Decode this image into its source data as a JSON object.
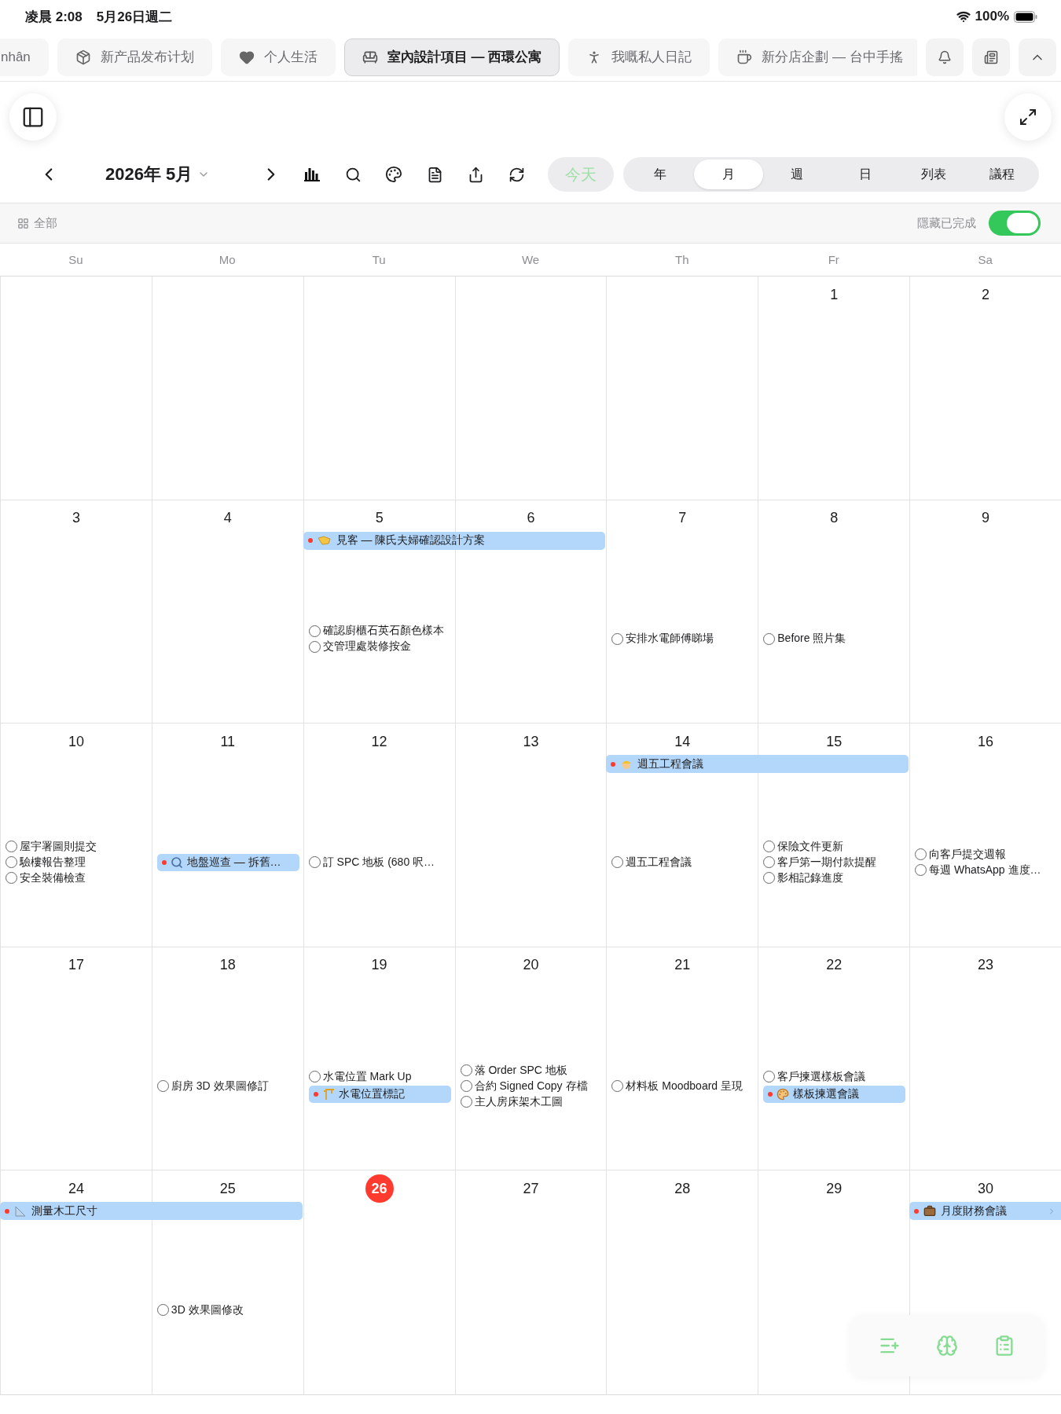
{
  "status_bar": {
    "time": "凌晨 2:08",
    "date": "5月26日週二",
    "battery": "100%"
  },
  "tabs": [
    {
      "label": "nhân",
      "selected": false
    },
    {
      "label": "新产品发布计划",
      "selected": false
    },
    {
      "label": "个人生活",
      "selected": false
    },
    {
      "label": "室內設計項目 — 西環公寓",
      "selected": true
    },
    {
      "label": "我嘅私人日記",
      "selected": false
    },
    {
      "label": "新分店企劃 — 台中手搖",
      "selected": false
    }
  ],
  "toolbar": {
    "month": "2026年 5月",
    "today": "今天",
    "views": [
      {
        "label": "年",
        "selected": false
      },
      {
        "label": "月",
        "selected": true
      },
      {
        "label": "週",
        "selected": false
      },
      {
        "label": "日",
        "selected": false
      },
      {
        "label": "列表",
        "selected": false
      },
      {
        "label": "議程",
        "selected": false
      }
    ]
  },
  "filter_bar": {
    "filter": "全部",
    "hide_completed": {
      "label": "隱藏已完成",
      "on": true
    }
  },
  "weekdays": [
    "Su",
    "Mo",
    "Tu",
    "We",
    "Th",
    "Fr",
    "Sa"
  ],
  "weeks": [
    {
      "days": [
        {
          "date": "1"
        },
        {
          "date": "2"
        }
      ]
    },
    {
      "days": [
        {
          "date": "3"
        },
        {
          "date": "4"
        },
        {
          "date": "5",
          "bar": {
            "title": "見客 — 陳氏夫婦確認設計方案"
          },
          "items": [
            {
              "kind": "task",
              "title": "確認廚櫃石英石顏色樣本",
              "done": false
            },
            {
              "kind": "task",
              "title": "交管理處裝修按金",
              "done": false
            }
          ]
        },
        {
          "date": "6",
          "bar_continues": true
        },
        {
          "date": "7",
          "items": [
            {
              "kind": "task",
              "title": "安排水電師傅睇場",
              "done": false
            }
          ]
        },
        {
          "date": "8",
          "items": [
            {
              "kind": "task",
              "title": "Before 照片集",
              "done": false
            }
          ]
        },
        {
          "date": "9"
        }
      ]
    },
    {
      "days": [
        {
          "date": "10",
          "items": [
            {
              "kind": "task",
              "title": "屋宇署圖則提交",
              "done": false
            },
            {
              "kind": "task",
              "title": "驗樓報告整理",
              "done": false
            },
            {
              "kind": "task",
              "title": "安全裝備檢查",
              "done": false
            }
          ]
        },
        {
          "date": "11",
          "items": [
            {
              "kind": "event",
              "title": "地盤巡查 — 拆舊…"
            }
          ]
        },
        {
          "date": "12",
          "items": [
            {
              "kind": "task",
              "title": "訂 SPC 地板 (680 呎…",
              "done": false
            }
          ]
        },
        {
          "date": "13"
        },
        {
          "date": "14",
          "bar": {
            "title": "週五工程會議"
          },
          "items": [
            {
              "kind": "task",
              "title": "週五工程會議",
              "done": false
            }
          ]
        },
        {
          "date": "15",
          "bar_continues": true,
          "items": [
            {
              "kind": "task",
              "title": "保險文件更新",
              "done": false
            },
            {
              "kind": "task",
              "title": "客戶第一期付款提醒",
              "done": false
            },
            {
              "kind": "task",
              "title": "影相記錄進度",
              "done": false
            }
          ]
        },
        {
          "date": "16",
          "items": [
            {
              "kind": "task",
              "title": "向客戶提交週報",
              "done": false
            },
            {
              "kind": "task",
              "title": "每週 WhatsApp 進度…",
              "done": false
            }
          ]
        }
      ]
    },
    {
      "days": [
        {
          "date": "17"
        },
        {
          "date": "18",
          "items": [
            {
              "kind": "task",
              "title": "廚房 3D 效果圖修訂",
              "done": false
            }
          ]
        },
        {
          "date": "19",
          "items": [
            {
              "kind": "task",
              "title": "水電位置 Mark Up",
              "done": false
            },
            {
              "kind": "event",
              "title": "水電位置標記"
            }
          ]
        },
        {
          "date": "20",
          "items": [
            {
              "kind": "task",
              "title": "落 Order SPC 地板",
              "done": false
            },
            {
              "kind": "task",
              "title": "合約 Signed Copy 存檔",
              "done": false
            },
            {
              "kind": "task",
              "title": "主人房床架木工圖",
              "done": false
            }
          ]
        },
        {
          "date": "21",
          "items": [
            {
              "kind": "task",
              "title": "材料板 Moodboard 呈現",
              "done": false
            }
          ]
        },
        {
          "date": "22",
          "items": [
            {
              "kind": "task",
              "title": "客戶揀選樣板會議",
              "done": false
            },
            {
              "kind": "event",
              "title": "樣板揀選會議"
            }
          ]
        },
        {
          "date": "23"
        }
      ]
    },
    {
      "days": [
        {
          "date": "24",
          "bar": {
            "title": "測量木工尺寸"
          }
        },
        {
          "date": "25",
          "bar_continues": true,
          "items": [
            {
              "kind": "task",
              "title": "3D 效果圖修改",
              "done": false
            }
          ]
        },
        {
          "date": "26",
          "today": true
        },
        {
          "date": "27"
        },
        {
          "date": "28"
        },
        {
          "date": "29"
        },
        {
          "date": "30",
          "bar": {
            "title": "月度財務會議",
            "continues_next": true
          }
        }
      ]
    }
  ]
}
